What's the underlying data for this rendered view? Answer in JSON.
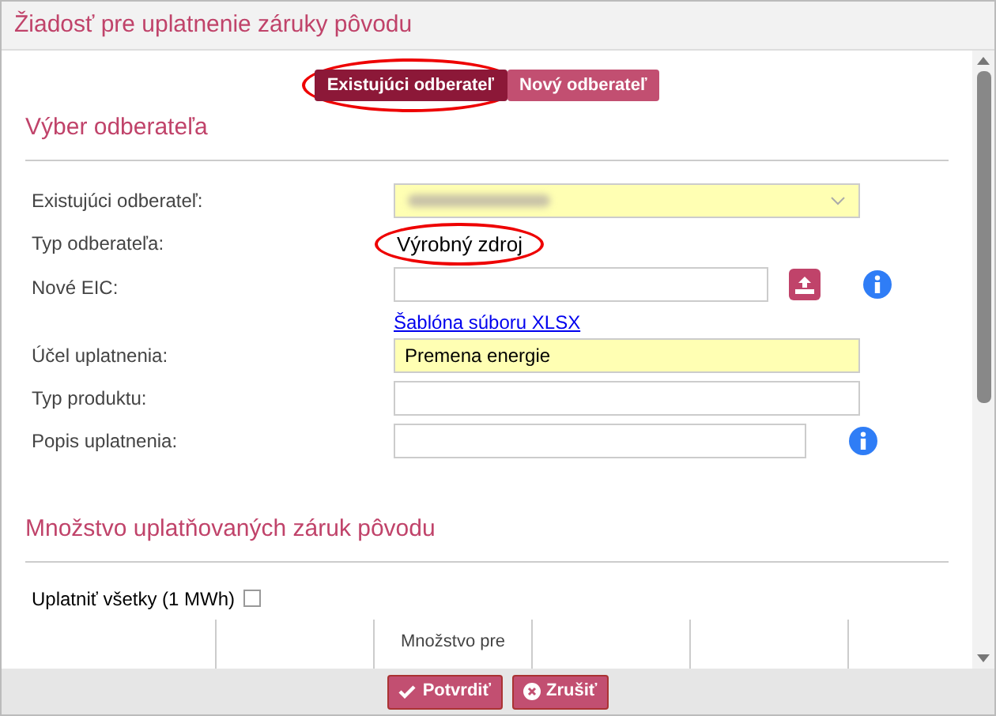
{
  "window": {
    "title": "Žiadosť pre uplatnenie záruky pôvodu"
  },
  "tabs": [
    {
      "label": "Existujúci odberateľ",
      "selected": true,
      "circled": true
    },
    {
      "label": "Nový odberateľ",
      "selected": false,
      "circled": false
    }
  ],
  "section_1": {
    "title": "Výber odberateľa"
  },
  "fields": [
    {
      "kind": "select",
      "label": "Existujúci odberateľ:",
      "blurred": true,
      "highlighted": true
    },
    {
      "kind": "text",
      "label": "Typ odberateľa:",
      "value": "Výrobný zdroj",
      "circled": true
    },
    {
      "kind": "upload",
      "label": "Nové EIC:",
      "info": true,
      "link": "Šablóna súboru XLSX"
    },
    {
      "kind": "input",
      "label": "Účel uplatnenia:",
      "value": "Premena energie",
      "highlighted": true
    },
    {
      "kind": "input",
      "label": "Typ produktu:",
      "highlighted": false
    },
    {
      "kind": "input",
      "label": "Popis uplatnenia:",
      "info": true,
      "highlighted": false
    }
  ],
  "section_2": {
    "title": "Množstvo uplatňovaných záruk pôvodu"
  },
  "apply_all": {
    "label": "Uplatniť všetky (1 MWh)",
    "checked": false
  },
  "table": {
    "columns": [
      "",
      "",
      "Množstvo pre",
      "",
      "",
      ""
    ]
  },
  "buttons": [
    {
      "kind": "confirm",
      "label": "Potvrdiť"
    },
    {
      "kind": "cancel",
      "label": "Zrušiť"
    }
  ]
}
